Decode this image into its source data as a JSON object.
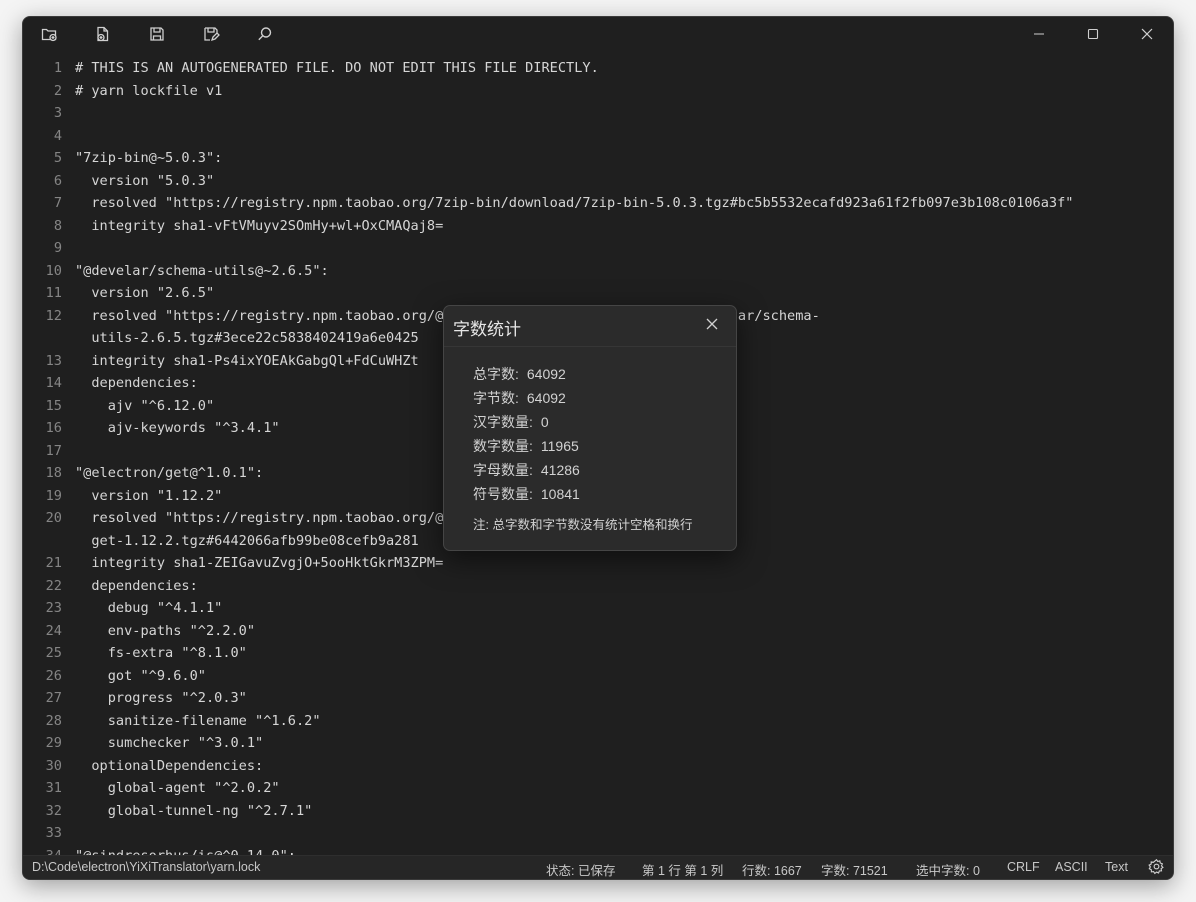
{
  "toolbar": {
    "icons": [
      "new-file-icon",
      "open-file-icon",
      "save-icon",
      "save-as-icon",
      "search-icon"
    ]
  },
  "window_controls": [
    "minimize-icon",
    "maximize-icon",
    "close-icon"
  ],
  "editor": {
    "lines": [
      {
        "num": "1",
        "text": "# THIS IS AN AUTOGENERATED FILE. DO NOT EDIT THIS FILE DIRECTLY."
      },
      {
        "num": "2",
        "text": "# yarn lockfile v1"
      },
      {
        "num": "3",
        "text": ""
      },
      {
        "num": "4",
        "text": ""
      },
      {
        "num": "5",
        "text": "\"7zip-bin@~5.0.3\":"
      },
      {
        "num": "6",
        "text": "  version \"5.0.3\""
      },
      {
        "num": "7",
        "text": "  resolved \"https://registry.npm.taobao.org/7zip-bin/download/7zip-bin-5.0.3.tgz#bc5b5532ecafd923a61f2fb097e3b108c0106a3f\""
      },
      {
        "num": "8",
        "text": "  integrity sha1-vFtVMuyv2SOmHy+wl+OxCMAQaj8="
      },
      {
        "num": "9",
        "text": ""
      },
      {
        "num": "10",
        "text": "\"@develar/schema-utils@~2.6.5\":"
      },
      {
        "num": "11",
        "text": "  version \"2.6.5\""
      },
      {
        "num": "12",
        "text": "  resolved \"https://registry.npm.taobao.org/@develar/schema-utils/download/@develar/schema-"
      },
      {
        "num": "",
        "text": "  utils-2.6.5.tgz#3ece22c5838402419a6e0425"
      },
      {
        "num": "13",
        "text": "  integrity sha1-Ps4ixYOEAkGabgQl+FdCuWHZt"
      },
      {
        "num": "14",
        "text": "  dependencies:"
      },
      {
        "num": "15",
        "text": "    ajv \"^6.12.0\""
      },
      {
        "num": "16",
        "text": "    ajv-keywords \"^3.4.1\""
      },
      {
        "num": "17",
        "text": ""
      },
      {
        "num": "18",
        "text": "\"@electron/get@^1.0.1\":"
      },
      {
        "num": "19",
        "text": "  version \"1.12.2\""
      },
      {
        "num": "20",
        "text": "  resolved \"https://registry.npm.taobao.org/@electron/get/download/@electron/"
      },
      {
        "num": "",
        "text": "  get-1.12.2.tgz#6442066afb99be08cefb9a281"
      },
      {
        "num": "21",
        "text": "  integrity sha1-ZEIGavuZvgjO+5ooHktGkrM3ZPM="
      },
      {
        "num": "22",
        "text": "  dependencies:"
      },
      {
        "num": "23",
        "text": "    debug \"^4.1.1\""
      },
      {
        "num": "24",
        "text": "    env-paths \"^2.2.0\""
      },
      {
        "num": "25",
        "text": "    fs-extra \"^8.1.0\""
      },
      {
        "num": "26",
        "text": "    got \"^9.6.0\""
      },
      {
        "num": "27",
        "text": "    progress \"^2.0.3\""
      },
      {
        "num": "28",
        "text": "    sanitize-filename \"^1.6.2\""
      },
      {
        "num": "29",
        "text": "    sumchecker \"^3.0.1\""
      },
      {
        "num": "30",
        "text": "  optionalDependencies:"
      },
      {
        "num": "31",
        "text": "    global-agent \"^2.0.2\""
      },
      {
        "num": "32",
        "text": "    global-tunnel-ng \"^2.7.1\""
      },
      {
        "num": "33",
        "text": ""
      },
      {
        "num": "34",
        "text": "\"@sindresorhus/is@^0.14.0\":"
      }
    ]
  },
  "status": {
    "path": "D:\\Code\\electron\\YiXiTranslator\\yarn.lock",
    "state": "状态:  已保存",
    "position": "第 1 行 第 1 列",
    "lines": "行数: 1667",
    "chars": "字数:  71521",
    "selected": "选中字数:  0",
    "eol": "CRLF",
    "encoding": "ASCII",
    "mode": "Text"
  },
  "dialog": {
    "title": "字数统计",
    "stats": [
      {
        "label": "总字数:",
        "value": "64092"
      },
      {
        "label": "字节数:",
        "value": "64092"
      },
      {
        "label": "汉字数量:",
        "value": "0"
      },
      {
        "label": "数字数量:",
        "value": "11965"
      },
      {
        "label": "字母数量:",
        "value": "41286"
      },
      {
        "label": "符号数量:",
        "value": "10841"
      }
    ],
    "note": "注: 总字数和字节数没有统计空格和换行"
  }
}
